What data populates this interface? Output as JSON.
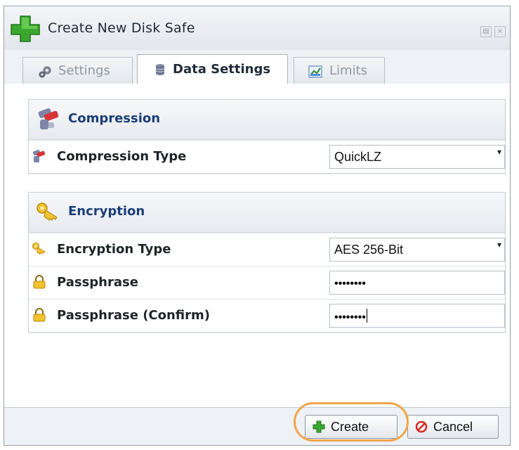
{
  "window": {
    "title": "Create New Disk Safe",
    "title_icon": "green-plus-icon",
    "controls": [
      "restore-icon",
      "close-icon"
    ]
  },
  "tabs": [
    {
      "label": "Settings",
      "icon": "gear-icon",
      "active": false
    },
    {
      "label": "Data Settings",
      "icon": "database-icon",
      "active": true
    },
    {
      "label": "Limits",
      "icon": "chart-icon",
      "active": false
    }
  ],
  "compression": {
    "heading": "Compression",
    "icon": "compression-icon",
    "rows": [
      {
        "label": "Compression Type",
        "icon": "compression-icon",
        "value": "QuickLZ"
      }
    ]
  },
  "encryption": {
    "heading": "Encryption",
    "icon": "keys-icon",
    "type_label": "Encryption Type",
    "type_value": "AES 256-Bit",
    "passphrase_label": "Passphrase",
    "passphrase_value": "••••••••",
    "confirm_label": "Passphrase (Confirm)",
    "confirm_value": "••••••••"
  },
  "buttons": {
    "create": "Create",
    "cancel": "Cancel"
  },
  "colors": {
    "heading": "#1b3e78",
    "highlight": "#f0a54a",
    "plus_green": "#3aa82e",
    "cancel_red": "#d42a20"
  }
}
